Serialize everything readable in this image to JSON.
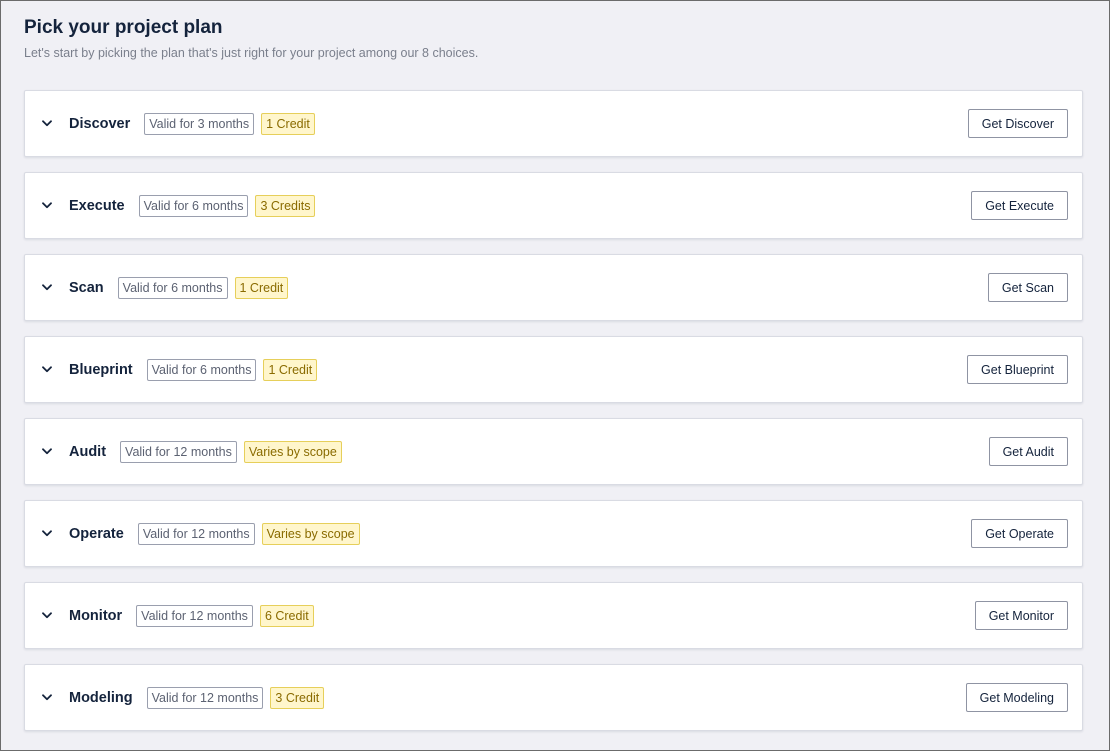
{
  "header": {
    "title": "Pick your project plan",
    "subtitle": "Let's start by picking the plan that's just right for your project among our 8 choices."
  },
  "plans": [
    {
      "name": "Discover",
      "validity": "Valid for 3 months",
      "credit": "1 Credit",
      "button": "Get Discover"
    },
    {
      "name": "Execute",
      "validity": "Valid for 6 months",
      "credit": "3 Credits",
      "button": "Get Execute"
    },
    {
      "name": "Scan",
      "validity": "Valid for 6 months",
      "credit": "1 Credit",
      "button": "Get Scan"
    },
    {
      "name": "Blueprint",
      "validity": "Valid for 6 months",
      "credit": "1 Credit",
      "button": "Get Blueprint"
    },
    {
      "name": "Audit",
      "validity": "Valid for 12 months",
      "credit": "Varies by scope",
      "button": "Get Audit"
    },
    {
      "name": "Operate",
      "validity": "Valid for 12 months",
      "credit": "Varies by scope",
      "button": "Get Operate"
    },
    {
      "name": "Monitor",
      "validity": "Valid for 12 months",
      "credit": "6 Credit",
      "button": "Get Monitor"
    },
    {
      "name": "Modeling",
      "validity": "Valid for 12 months",
      "credit": "3 Credit",
      "button": "Get Modeling"
    }
  ],
  "icons": {
    "expand": "chevron-down-icon"
  },
  "colors": {
    "background": "#f0f0f5",
    "card": "#ffffff",
    "text": "#14233c",
    "muted": "#7a7f8c",
    "credit_bg": "#fff6cc",
    "credit_border": "#e6cf5a",
    "credit_text": "#8a6b00"
  }
}
